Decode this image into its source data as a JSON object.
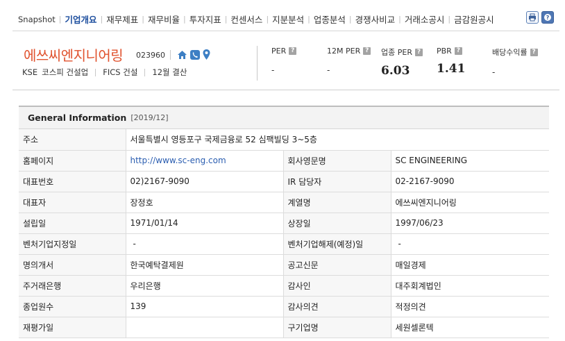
{
  "nav": {
    "tabs": [
      "Snapshot",
      "기업개요",
      "재무제표",
      "재무비율",
      "투자지표",
      "컨센서스",
      "지분분석",
      "업종분석",
      "경쟁사비교",
      "거래소공시",
      "금감원공시"
    ],
    "active_index": 1
  },
  "header": {
    "company_name": "에쓰씨엔지니어링",
    "code": "023960",
    "icons": [
      "home-icon",
      "phone-icon",
      "map-pin-icon"
    ],
    "market": "KSE",
    "market_sector": "코스피 건설업",
    "fics": "FICS 건설",
    "settlement": "12월 결산",
    "metrics": [
      {
        "label": "PER",
        "value": "-"
      },
      {
        "label": "12M PER",
        "value": "-"
      },
      {
        "label": "업종 PER",
        "value": "6.03"
      },
      {
        "label": "PBR",
        "value": "1.41"
      },
      {
        "label": "배당수익률",
        "value": "-"
      }
    ]
  },
  "general_info": {
    "title": "General Information",
    "date": "[2019/12]",
    "address_label": "주소",
    "address": "서울특별시 영등포구 국제금융로 52 심팩빌딩 3~5층",
    "rows": [
      [
        "홈페이지",
        "http://www.sc-eng.com",
        "회사영문명",
        "SC ENGINEERING"
      ],
      [
        "대표번호",
        "02)2167-9090",
        "IR 담당자",
        "02-2167-9090"
      ],
      [
        "대표자",
        "장정호",
        "계열명",
        "에쓰씨엔지니어링"
      ],
      [
        "설립일",
        "1971/01/14",
        "상장일",
        "1997/06/23"
      ],
      [
        "벤처기업지정일",
        "-",
        "벤처기업해제(예정)일",
        "-"
      ],
      [
        "명의개서",
        "한국예탁결제원",
        "공고신문",
        "매일경제"
      ],
      [
        "주거래은행",
        "우리은행",
        "감사인",
        "대주회계법인"
      ],
      [
        "종업원수",
        "139",
        "감사의견",
        "적정의견"
      ],
      [
        "재평가일",
        "",
        "구기업명",
        "세원셀론텍"
      ]
    ]
  }
}
